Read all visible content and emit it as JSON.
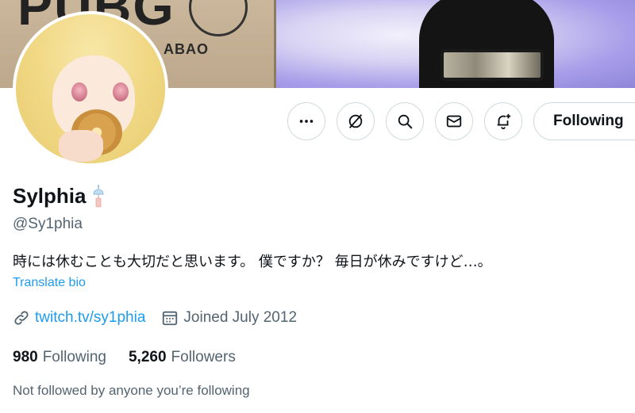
{
  "banner": {
    "box_text": "PUBG",
    "box_subtext": "ABAO"
  },
  "actions": {
    "more_icon": "more-horizontal-icon",
    "mute_icon": "grok-icon",
    "search_icon": "search-icon",
    "message_icon": "mail-icon",
    "notify_icon": "bell-plus-icon",
    "follow_label": "Following"
  },
  "profile": {
    "name": "Sylphia",
    "handle": "@Sy1phia",
    "bio": "時には休むことも大切だと思います。 僕ですか？ 毎日が休みですけど…。",
    "translate_label": "Translate bio",
    "website": "twitch.tv/sy1phia",
    "joined": "Joined July 2012",
    "following_count": "980",
    "following_label": "Following",
    "followers_count": "5,260",
    "followers_label": "Followers",
    "not_followed_text": "Not followed by anyone you’re following"
  },
  "colors": {
    "accent": "#1d9bf0",
    "muted_text": "#536471",
    "border": "#cfd9de"
  }
}
